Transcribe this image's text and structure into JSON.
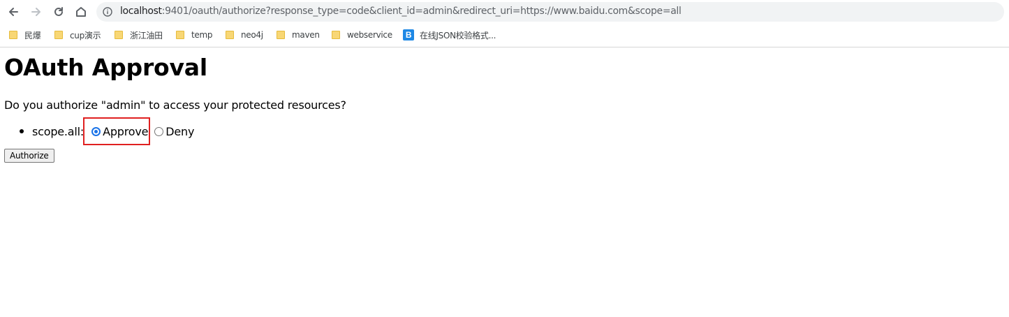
{
  "browser": {
    "url_host": "localhost",
    "url_rest": ":9401/oauth/authorize?response_type=code&client_id=admin&redirect_uri=https://www.baidu.com&scope=all",
    "bookmarks": [
      {
        "label": "民爆",
        "icon": "folder-icon"
      },
      {
        "label": "cup演示",
        "icon": "folder-icon"
      },
      {
        "label": "浙江油田",
        "icon": "folder-icon"
      },
      {
        "label": "temp",
        "icon": "folder-icon"
      },
      {
        "label": "neo4j",
        "icon": "folder-icon"
      },
      {
        "label": "maven",
        "icon": "folder-icon"
      },
      {
        "label": "webservice",
        "icon": "folder-icon"
      },
      {
        "label": "在线JSON校验格式...",
        "icon": "json-site-icon",
        "icon_letter": "B"
      }
    ]
  },
  "page": {
    "title": "OAuth Approval",
    "question": "Do you authorize \"admin\" to access your protected resources?",
    "scope": {
      "label": "scope.all:",
      "options": [
        {
          "label": "Approve",
          "checked": true
        },
        {
          "label": "Deny",
          "checked": false
        }
      ]
    },
    "submit_label": "Authorize"
  },
  "colors": {
    "highlight": "#e02020",
    "radio_checked": "#1a73e8",
    "folder": "#f8d775"
  }
}
